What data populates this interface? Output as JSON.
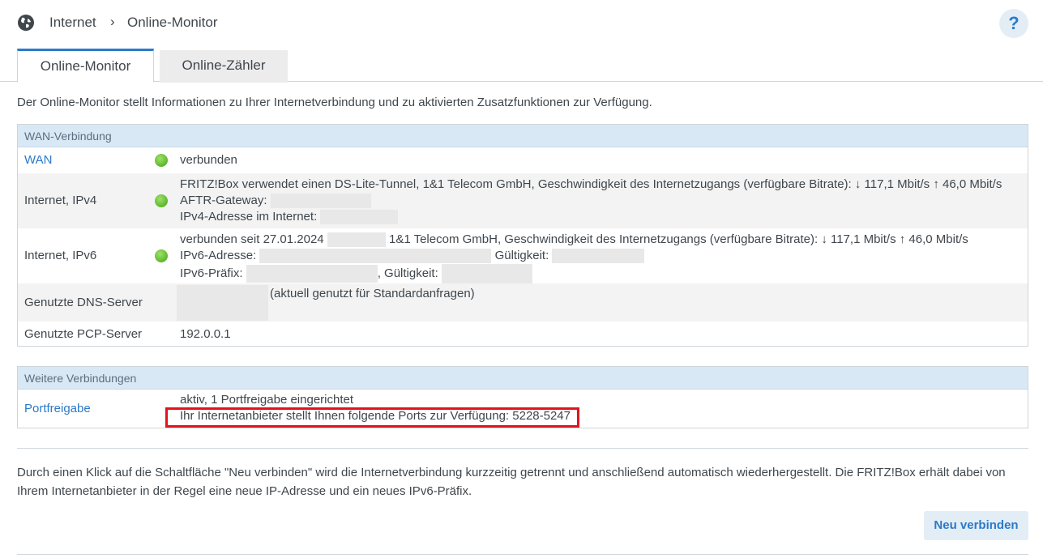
{
  "breadcrumb": {
    "section": "Internet",
    "separator": "›",
    "page": "Online-Monitor"
  },
  "help_label": "?",
  "tabs": [
    {
      "label": "Online-Monitor",
      "active": true
    },
    {
      "label": "Online-Zähler",
      "active": false
    }
  ],
  "intro": "Der Online-Monitor stellt Informationen zu Ihrer Internetverbindung und zu aktivierten Zusatzfunktionen zur Verfügung.",
  "wan_box": {
    "title": "WAN-Verbindung",
    "rows": {
      "wan": {
        "label": "WAN",
        "status": "verbunden"
      },
      "ipv4": {
        "label": "Internet, IPv4",
        "line1": "FRITZ!Box verwendet einen DS-Lite-Tunnel, 1&1 Telecom GmbH, Geschwindigkeit des Internetzugangs (verfügbare Bitrate): ↓ 117,1 Mbit/s ↑ 46,0 Mbit/s",
        "aftr_label": "AFTR-Gateway:",
        "ipv4_label": "IPv4-Adresse im Internet:"
      },
      "ipv6": {
        "label": "Internet, IPv6",
        "line1_prefix": "verbunden seit 27.01.2024",
        "line1_suffix": "1&1 Telecom GmbH, Geschwindigkeit des Internetzugangs (verfügbare Bitrate): ↓ 117,1 Mbit/s ↑ 46,0 Mbit/s",
        "addr_label": "IPv6-Adresse:",
        "valid_label": "Gültigkeit:",
        "prefix_label": "IPv6-Präfix:",
        "prefix_valid_label": ", Gültigkeit:"
      },
      "dns": {
        "label": "Genutzte DNS-Server",
        "note": "(aktuell genutzt für Standardanfragen)"
      },
      "pcp": {
        "label": "Genutzte PCP-Server",
        "value": "192.0.0.1"
      }
    }
  },
  "more_box": {
    "title": "Weitere Verbindungen",
    "portfreigabe": {
      "label": "Portfreigabe",
      "line1": "aktiv, 1 Portfreigabe eingerichtet",
      "line2": "Ihr Internetanbieter stellt Ihnen folgende Ports zur Verfügung: 5228-5247"
    }
  },
  "reconnect_note": "Durch einen Klick auf die Schaltfläche \"Neu verbinden\" wird die Internetverbindung kurzzeitig getrennt und anschließend automatisch wiederhergestellt. Die FRITZ!Box erhält dabei von Ihrem Internetanbieter in der Regel eine neue IP-Adresse und ein neues IPv6-Präfix.",
  "reconnect_button": "Neu verbinden",
  "colors": {
    "accent": "#2b7ac7",
    "status_ok": "#5cb82a",
    "highlight": "#e0141e"
  }
}
